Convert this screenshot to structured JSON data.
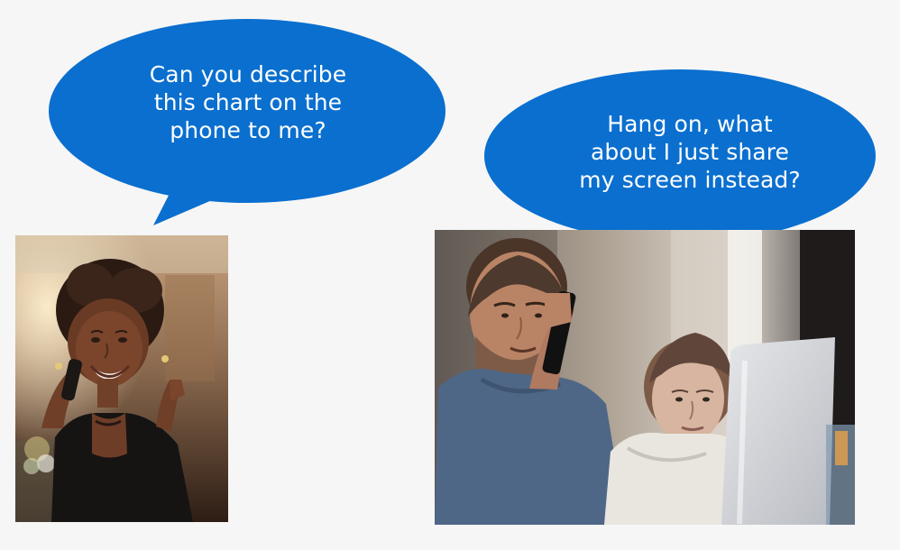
{
  "scene": {
    "left_bubble": {
      "text": "Can you describe\nthis chart on the\nphone to me?"
    },
    "right_bubble": {
      "text": "Hang on, what\nabout I just share\nmy screen instead?"
    }
  },
  "colors": {
    "background": "#f6f6f6",
    "bubble_fill": "#0a6fcf",
    "bubble_text": "#ffffff"
  }
}
